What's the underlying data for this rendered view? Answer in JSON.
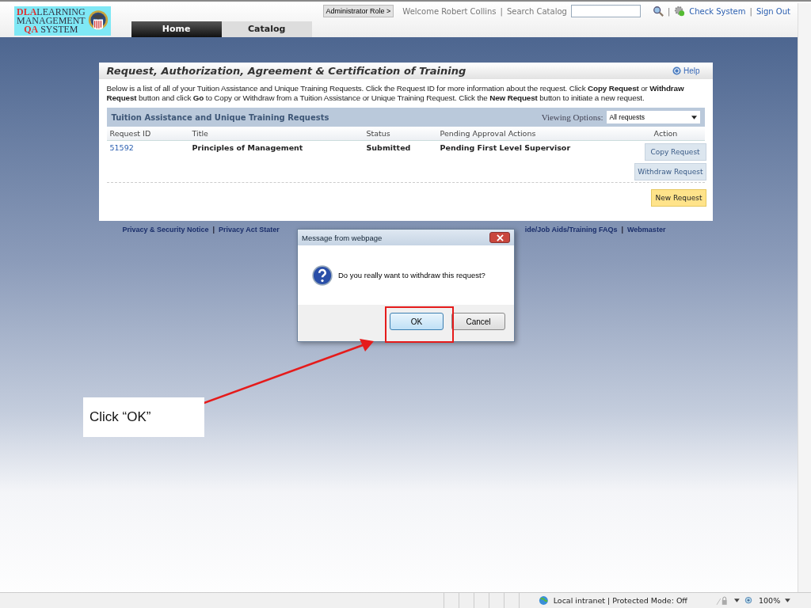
{
  "header": {
    "logo": {
      "dla": "DLA",
      "line1": "LEARNING",
      "line2": "MANAGEMENT",
      "qa": "QA",
      "line3": "SYSTEM"
    },
    "tabs": [
      {
        "label": "Home",
        "selected": true
      },
      {
        "label": "Catalog",
        "selected": false
      }
    ],
    "role_button": "Administrator Role >",
    "welcome": "Welcome Robert Collins",
    "separator": "|",
    "search_label": "Search Catalog",
    "check_system": "Check System",
    "sign_out": "Sign Out"
  },
  "panel": {
    "title": "Request, Authorization, Agreement & Certification of Training",
    "help": "Help",
    "intro": "Below is a list of all of your Tuition Assistance and Unique Training Requests. Click the Request ID for more information about the request. Click **Copy Request** or **Withdraw Request** button and click **Go** to Copy or Withdraw from a Tuition Assistance or Unique Training Request. Click the **New Request** button to initiate a new request.",
    "section_title": "Tuition Assistance and Unique Training Requests",
    "viewing_label": "Viewing Options:",
    "viewing_value": "All requests",
    "columns": [
      "Request ID",
      "Title",
      "Status",
      "Pending Approval Actions",
      "Action"
    ],
    "rows": [
      {
        "request_id": "51592",
        "title": "Principles of Management",
        "status": "Submitted",
        "pending": "Pending First Level Supervisor",
        "actions": [
          "Copy Request",
          "Withdraw Request"
        ]
      }
    ],
    "new_request": "New Request"
  },
  "footer_links": [
    {
      "text": "Privacy & Security Notice",
      "sep": "|"
    },
    {
      "text": "Privacy Act Stater"
    },
    {
      "text": "ide/Job Aids/Training FAQs",
      "sep": "|"
    },
    {
      "text": "Webmaster"
    }
  ],
  "dialog": {
    "title": "Message from webpage",
    "message": "Do you really want to withdraw this request?",
    "buttons": [
      {
        "label": "OK",
        "default": true
      },
      {
        "label": "Cancel",
        "default": false
      }
    ]
  },
  "annotation": {
    "label": "Click “OK”"
  },
  "status_bar": {
    "zone": "Local intranet | Protected Mode: Off",
    "zoom": "100%"
  }
}
